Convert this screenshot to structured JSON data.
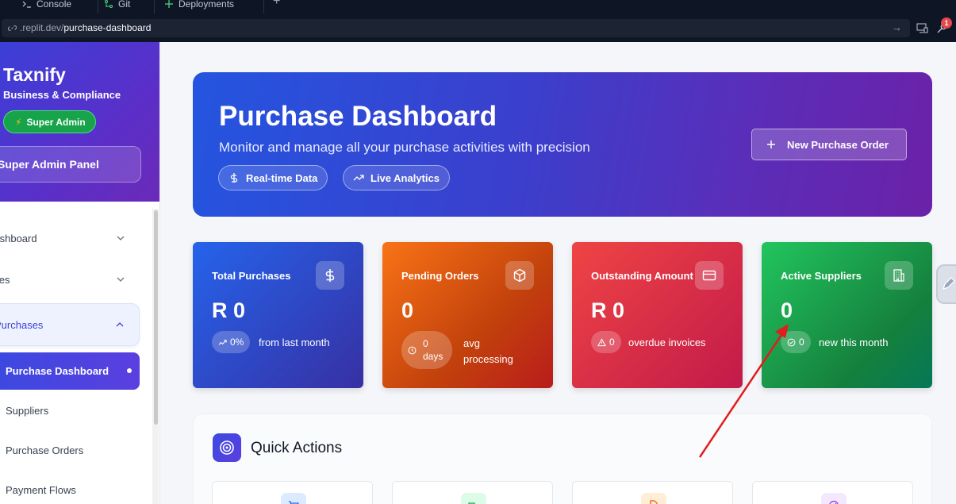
{
  "browser": {
    "tabs": [
      {
        "label": "Console",
        "icon": "terminal-icon"
      },
      {
        "label": "Git",
        "icon": "git-branch-icon"
      },
      {
        "label": "Deployments",
        "icon": "deployments-icon"
      }
    ],
    "url_domain": ".replit.dev/",
    "url_path": "purchase-dashboard",
    "notification_count": "1"
  },
  "sidebar": {
    "brand": "Taxnify",
    "brand_sub": "Business & Compliance",
    "role_badge": "Super Admin",
    "panel_button": "Super Admin Panel",
    "nav": [
      {
        "label": "Dashboard",
        "expanded": false
      },
      {
        "label": "Sales",
        "expanded": false
      },
      {
        "label": "Purchases",
        "expanded": true
      }
    ],
    "active_item": "Purchase Dashboard",
    "subitems": [
      "Suppliers",
      "Purchase Orders",
      "Payment Flows"
    ]
  },
  "hero": {
    "title": "Purchase Dashboard",
    "subtitle": "Monitor and manage all your purchase activities with precision",
    "chips": [
      "Real-time Data",
      "Live Analytics"
    ],
    "new_order_button": "New Purchase Order"
  },
  "stats": [
    {
      "label": "Total Purchases",
      "value": "R 0",
      "pill": "0%",
      "note": "from last month",
      "icon": "dollar-icon"
    },
    {
      "label": "Pending Orders",
      "value": "0",
      "pill_value": "0",
      "pill_unit": "days",
      "note_line1": "avg",
      "note_line2": "processing",
      "icon": "package-icon"
    },
    {
      "label": "Outstanding Amount",
      "value": "R 0",
      "pill": "0",
      "note": "overdue invoices",
      "icon": "credit-card-icon"
    },
    {
      "label": "Active Suppliers",
      "value": "0",
      "pill": "0",
      "note": "new this month",
      "icon": "building-icon"
    }
  ],
  "quick_actions": {
    "title": "Quick Actions",
    "action_icon_colors": [
      "#dbeafe",
      "#dcfce7",
      "#ffedd5",
      "#f3e8ff"
    ]
  },
  "colors": {
    "accent": "#4f46e5",
    "annotation_arrow": "#e11d1d"
  }
}
